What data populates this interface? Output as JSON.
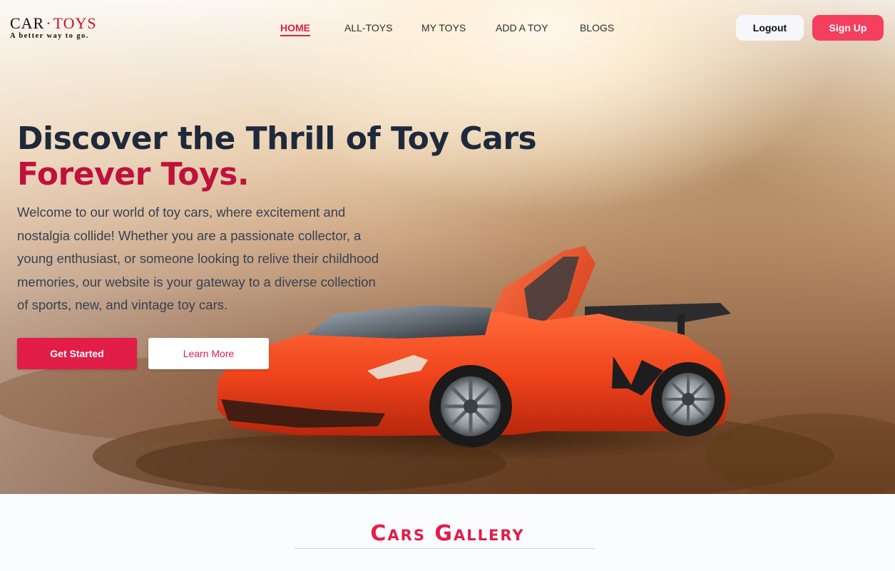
{
  "brand": {
    "name_part1": "CAR",
    "separator": "·",
    "name_part2": "TOYS",
    "tagline": "A better way to go."
  },
  "nav": {
    "items": [
      {
        "label": "HOME",
        "active": true
      },
      {
        "label": "ALL-TOYS",
        "active": false
      },
      {
        "label": "MY TOYS",
        "active": false
      },
      {
        "label": "ADD A TOY",
        "active": false
      },
      {
        "label": "BLOGS",
        "active": false
      }
    ],
    "logout_label": "Logout",
    "signup_label": "Sign Up"
  },
  "hero": {
    "title": "Discover the Thrill of Toy Cars",
    "subtitle": "Forever Toys.",
    "description": "Welcome to our world of toy cars, where excitement and nostalgia collide! Whether you are a passionate collector, a young enthusiast, or someone looking to relive their childhood memories, our website is your gateway to a diverse collection of sports, new, and vintage toy cars.",
    "primary_button": "Get Started",
    "secondary_button": "Learn More"
  },
  "gallery": {
    "title": "Cars Gallery"
  },
  "colors": {
    "accent": "#e11d48",
    "accent_dark": "#be123c",
    "signup": "#f43f5e",
    "heading": "#1e293b",
    "car_body": "#f0441c"
  }
}
